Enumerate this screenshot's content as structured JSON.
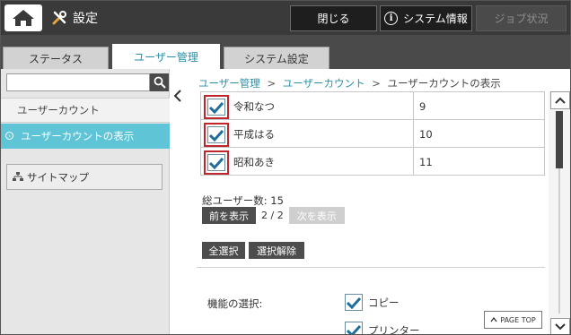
{
  "header": {
    "title": "設定",
    "buttons": {
      "close": "閉じる",
      "system_info": "システム情報",
      "job_status": "ジョブ状況"
    }
  },
  "tabs": [
    {
      "label": "ステータス"
    },
    {
      "label": "ユーザー管理"
    },
    {
      "label": "システム設定"
    }
  ],
  "sidebar": {
    "search": {
      "value": "",
      "placeholder": ""
    },
    "parent_item": "ユーザーカウント",
    "current_item": "ユーザーカウントの表示",
    "sitemap_label": "サイトマップ"
  },
  "breadcrumb": {
    "items": [
      "ユーザー管理",
      "ユーザーカウント",
      "ユーザーカウントの表示"
    ],
    "separator": ">"
  },
  "users": {
    "rows": [
      {
        "name": "令和なつ",
        "count": "9",
        "checked": true
      },
      {
        "name": "平成はる",
        "count": "10",
        "checked": true
      },
      {
        "name": "昭和あき",
        "count": "11",
        "checked": true
      }
    ]
  },
  "summary": {
    "total_label": "総ユーザー数: 15"
  },
  "pager": {
    "prev": "前を表示",
    "page": "2 / 2",
    "next": "次を表示"
  },
  "actions": {
    "select_all": "全選択",
    "deselect": "選択解除"
  },
  "functions": {
    "label": "機能の選択:",
    "items": [
      {
        "label": "コピー",
        "checked": true
      },
      {
        "label": "プリンター",
        "checked": true
      }
    ]
  },
  "page_top": "PAGE TOP",
  "colors": {
    "accent": "#2a8fa6",
    "nav_selected": "#5ec4d6",
    "highlight_border": "#c0272d",
    "topbar": "#3a3a3a"
  }
}
